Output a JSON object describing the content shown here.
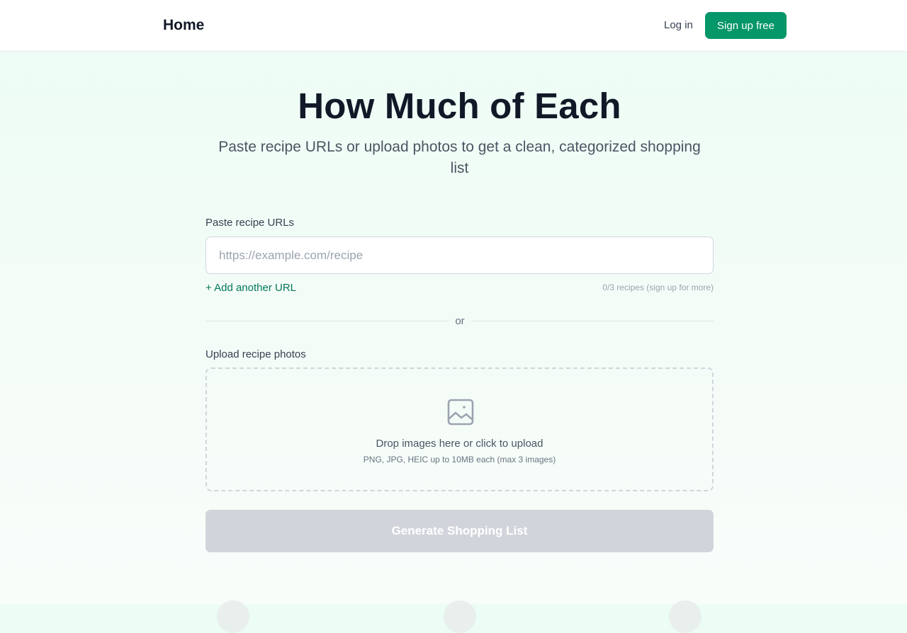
{
  "header": {
    "logo": "Home",
    "login_label": "Log in",
    "signup_label": "Sign up free"
  },
  "hero": {
    "title": "How Much of Each",
    "subtitle": "Paste recipe URLs or upload photos to get a clean, categorized shopping list"
  },
  "url_section": {
    "label": "Paste recipe URLs",
    "input_value": "",
    "input_placeholder": "https://example.com/recipe",
    "add_label": "+ Add another URL",
    "counter": "0/3 recipes (sign up for more)"
  },
  "divider": {
    "text": "or"
  },
  "upload_section": {
    "label": "Upload recipe photos",
    "icon": "image-icon",
    "drop_text": "Drop images here or click to upload",
    "drop_hint": "PNG, JPG, HEIC up to 10MB each (max 3 images)"
  },
  "generate": {
    "label": "Generate Shopping List",
    "disabled": true
  },
  "colors": {
    "accent": "#059669",
    "link": "#047857",
    "disabled_button": "#d1d5db",
    "title": "#111827"
  }
}
